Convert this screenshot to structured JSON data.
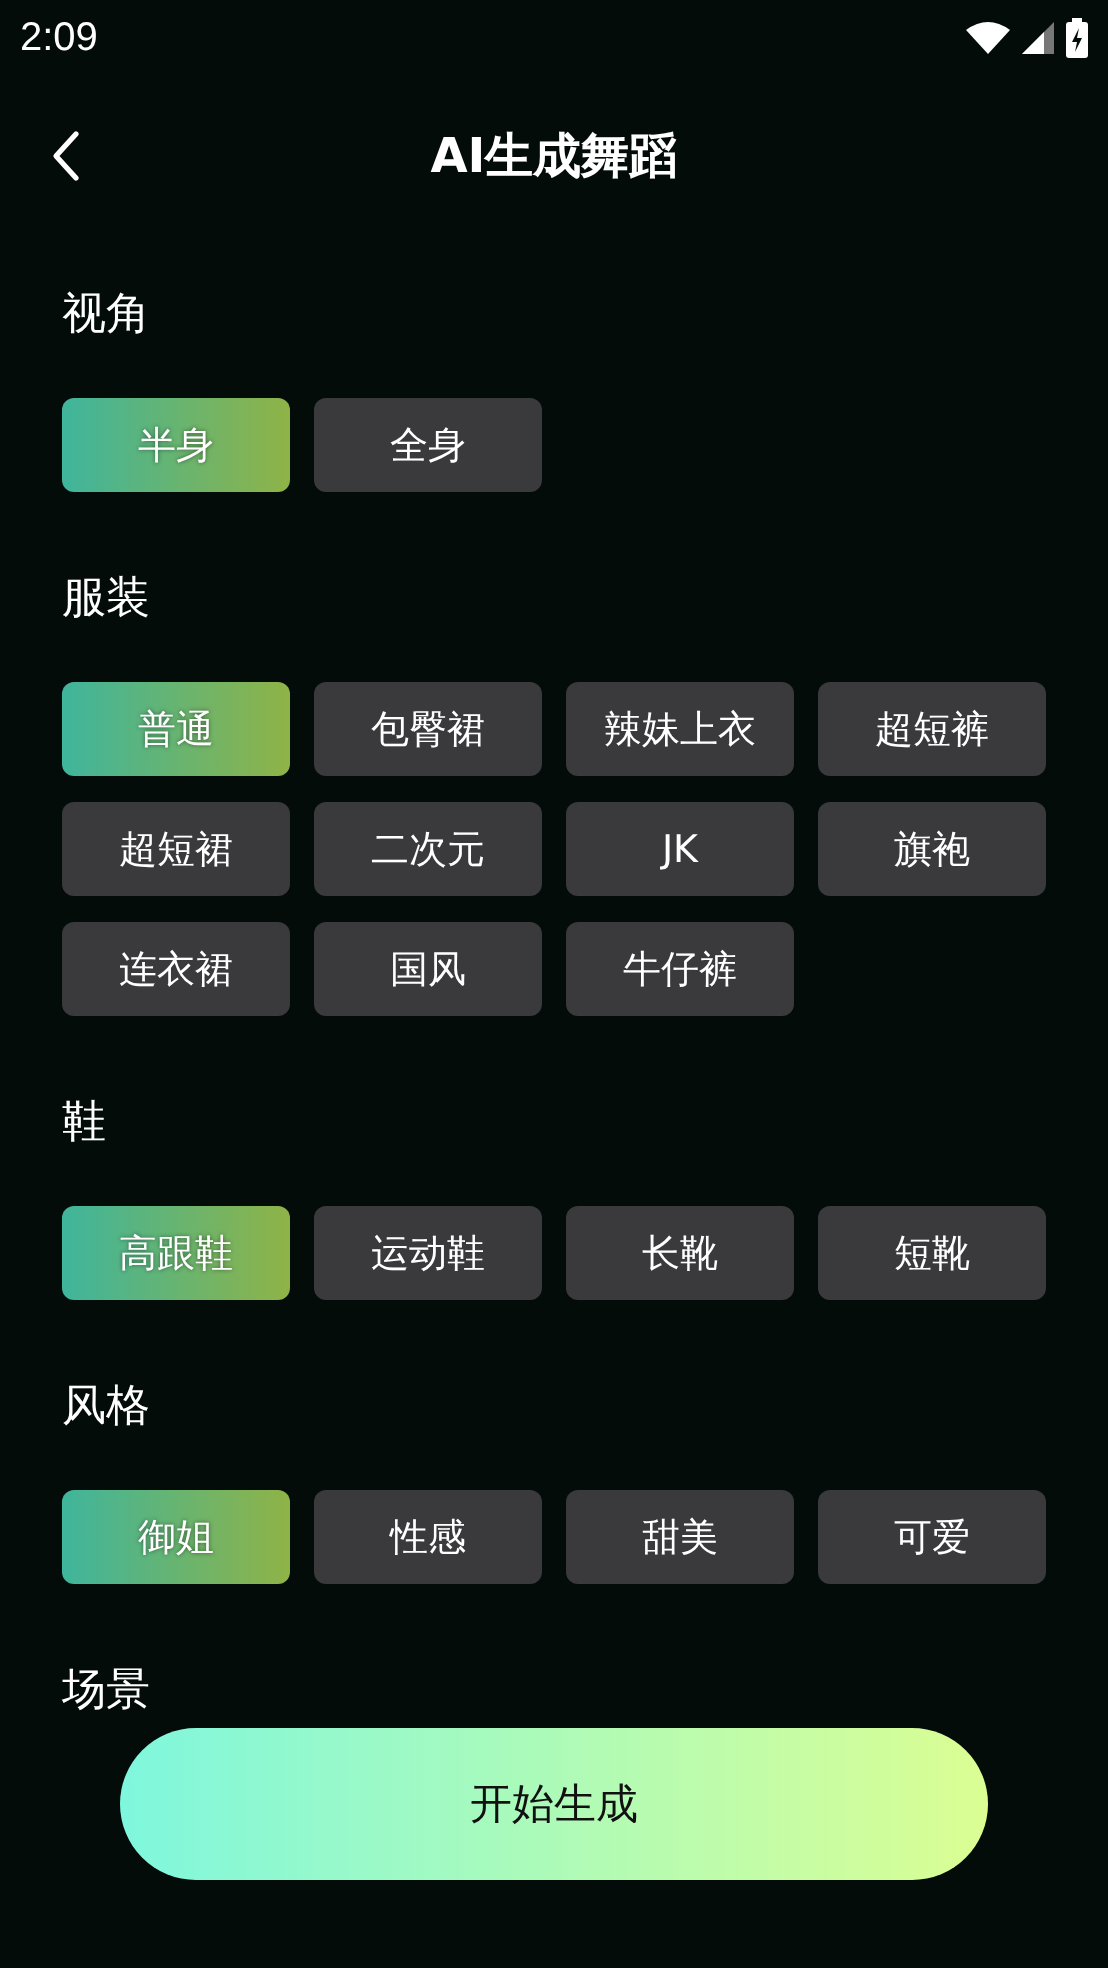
{
  "status_bar": {
    "time": "2:09"
  },
  "header": {
    "title": "AI生成舞蹈"
  },
  "sections": [
    {
      "label": "视角",
      "options": [
        {
          "label": "半身",
          "selected": true
        },
        {
          "label": "全身",
          "selected": false
        }
      ]
    },
    {
      "label": "服装",
      "options": [
        {
          "label": "普通",
          "selected": true
        },
        {
          "label": "包臀裙",
          "selected": false
        },
        {
          "label": "辣妹上衣",
          "selected": false
        },
        {
          "label": "超短裤",
          "selected": false
        },
        {
          "label": "超短裙",
          "selected": false
        },
        {
          "label": "二次元",
          "selected": false
        },
        {
          "label": "JK",
          "selected": false
        },
        {
          "label": "旗袍",
          "selected": false
        },
        {
          "label": "连衣裙",
          "selected": false
        },
        {
          "label": "国风",
          "selected": false
        },
        {
          "label": "牛仔裤",
          "selected": false
        }
      ]
    },
    {
      "label": "鞋",
      "options": [
        {
          "label": "高跟鞋",
          "selected": true
        },
        {
          "label": "运动鞋",
          "selected": false
        },
        {
          "label": "长靴",
          "selected": false
        },
        {
          "label": "短靴",
          "selected": false
        }
      ]
    },
    {
      "label": "风格",
      "options": [
        {
          "label": "御姐",
          "selected": true
        },
        {
          "label": "性感",
          "selected": false
        },
        {
          "label": "甜美",
          "selected": false
        },
        {
          "label": "可爱",
          "selected": false
        }
      ]
    },
    {
      "label": "场景"
    }
  ],
  "primary_button": {
    "label": "开始生成"
  }
}
